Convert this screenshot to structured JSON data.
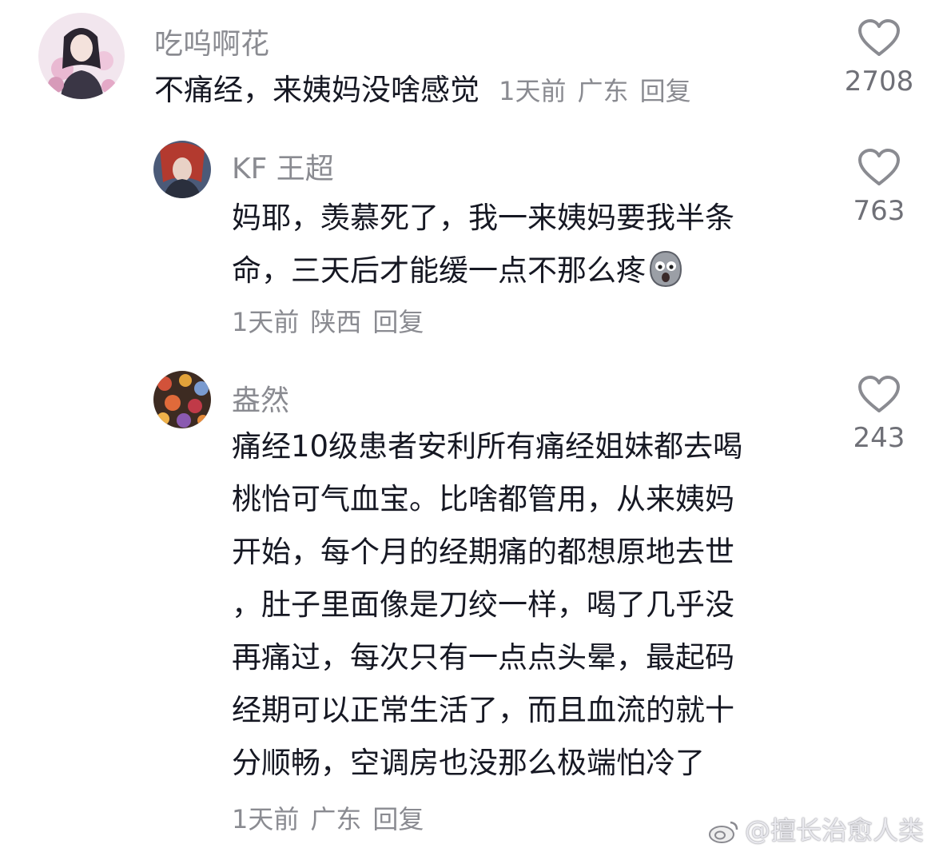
{
  "comments": [
    {
      "username": "吃呜啊花",
      "text": "不痛经，来姨妈没啥感觉",
      "time": "1天前",
      "location": "广东",
      "reply_label": "回复",
      "likes": "2708"
    },
    {
      "username": "KF 王超",
      "text_lines": [
        "妈耶，羡慕死了，我一来姨妈要我半条",
        "命，三天后才能缓一点不那么疼"
      ],
      "emoji": "scared-face-emoji",
      "time": "1天前",
      "location": "陕西",
      "reply_label": "回复",
      "likes": "763"
    },
    {
      "username": "盎然",
      "text_lines": [
        "痛经10级患者安利所有痛经姐妹都去喝",
        "桃怡可气血宝。比啥都管用，从来姨妈",
        "开始，每个月的经期痛的都想原地去世",
        "，肚子里面像是刀绞一样，喝了几乎没",
        "再痛过，每次只有一点点头晕，最起码",
        "经期可以正常生活了，而且血流的就十",
        "分顺畅，空调房也没那么极端怕冷了"
      ],
      "time": "1天前",
      "location": "广东",
      "reply_label": "回复",
      "likes": "243"
    }
  ],
  "watermark": "@擅长治愈人类",
  "icons": {
    "like": "heart-outline-icon",
    "watermark": "weibo-icon"
  },
  "colors": {
    "text": "#161823",
    "meta": "#8a8b91"
  }
}
